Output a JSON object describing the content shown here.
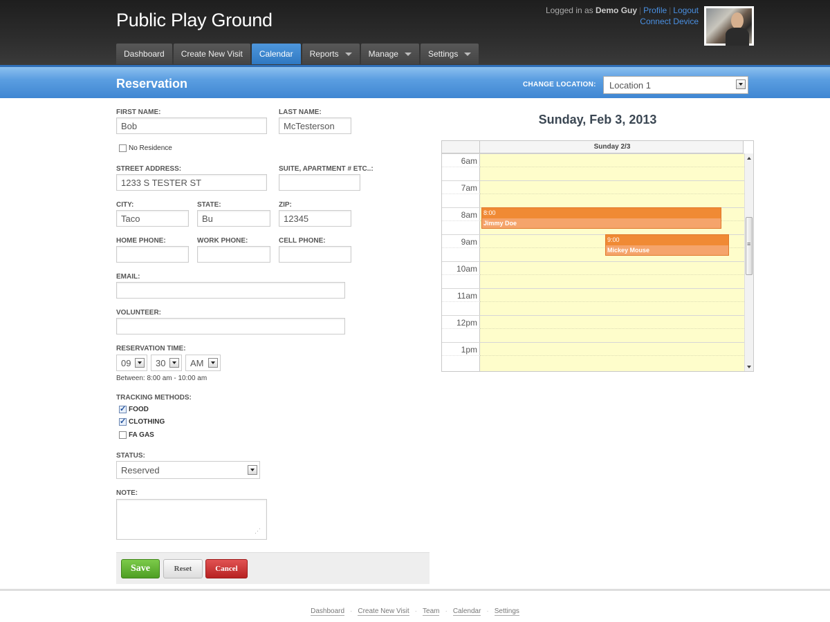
{
  "app": {
    "title": "Public Play Ground"
  },
  "user": {
    "logged_in_prefix": "Logged in as",
    "name": "Demo Guy",
    "profile": "Profile",
    "logout": "Logout",
    "connect_device": "Connect Device"
  },
  "nav": {
    "tabs": [
      {
        "label": "Dashboard"
      },
      {
        "label": "Create New Visit"
      },
      {
        "label": "Calendar"
      },
      {
        "label": "Reports"
      },
      {
        "label": "Manage"
      },
      {
        "label": "Settings"
      }
    ]
  },
  "band": {
    "title": "Reservation",
    "location_label": "CHANGE LOCATION:",
    "location_value": "Location 1"
  },
  "form": {
    "first_name_label": "FIRST NAME:",
    "first_name": "Bob",
    "last_name_label": "LAST NAME:",
    "last_name": "McTesterson",
    "no_residence": "No Residence",
    "street_label": "STREET ADDRESS:",
    "street": "1233 S TESTER ST",
    "suite_label": "SUITE, APARTMENT # ETC..:",
    "suite": "",
    "city_label": "CITY:",
    "city": "Taco",
    "state_label": "STATE:",
    "state": "Bu",
    "zip_label": "ZIP:",
    "zip": "12345",
    "home_phone_label": "HOME PHONE:",
    "home_phone": "",
    "work_phone_label": "WORK PHONE:",
    "work_phone": "",
    "cell_phone_label": "CELL PHONE:",
    "cell_phone": "",
    "email_label": "EMAIL:",
    "email": "",
    "volunteer_label": "VOLUNTEER:",
    "volunteer": "",
    "res_time_label": "RESERVATION TIME:",
    "hour": "09",
    "minute": "30",
    "ampm": "AM",
    "between": "Between: 8:00  am -  10:00 am",
    "tracking_label": "TRACKING METHODS:",
    "tracking": [
      {
        "label": "FOOD",
        "checked": true
      },
      {
        "label": "CLOTHING",
        "checked": true
      },
      {
        "label": "FA GAS",
        "checked": false
      }
    ],
    "status_label": "STATUS:",
    "status": "Reserved",
    "note_label": "NOTE:",
    "note": ""
  },
  "buttons": {
    "save": "Save",
    "reset": "Reset",
    "cancel": "Cancel"
  },
  "calendar": {
    "title": "Sunday, Feb 3, 2013",
    "day_header": "Sunday 2/3",
    "hours": [
      "6am",
      "7am",
      "8am",
      "9am",
      "10am",
      "11am",
      "12pm",
      "1pm"
    ],
    "events": [
      {
        "time": "8:00",
        "name": "Jimmy Doe"
      },
      {
        "time": "9:00",
        "name": "Mickey Mouse"
      }
    ]
  },
  "footer": {
    "links": [
      "Dashboard",
      "Create New Visit",
      "Team",
      "Calendar",
      "Settings"
    ]
  },
  "colors": {
    "accent": "#3f86d2",
    "event": "#f08a34",
    "save": "#4e9e23",
    "cancel": "#b72222"
  }
}
